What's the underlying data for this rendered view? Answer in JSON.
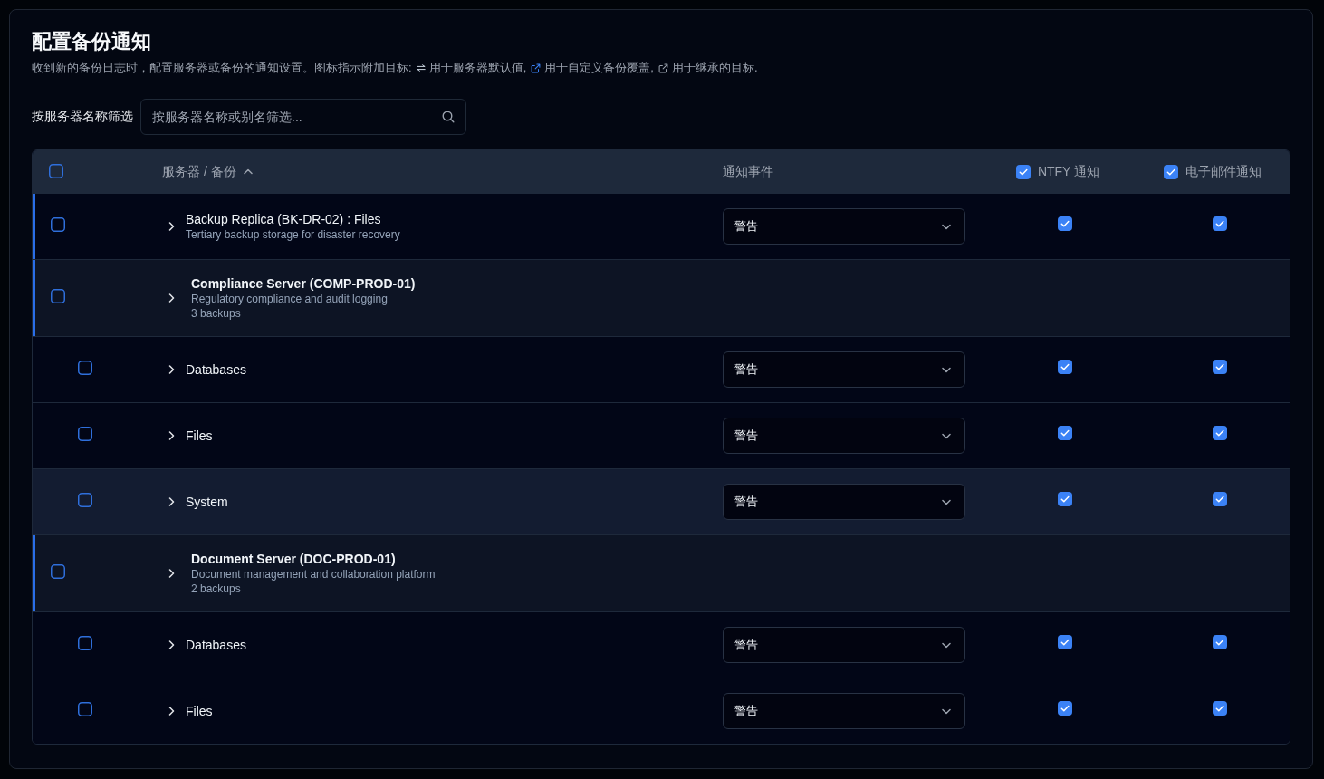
{
  "title": "配置备份通知",
  "description": {
    "intro": "收到新的备份日志时，配置服务器或备份的通知设置。图标指示附加目标:",
    "legend": [
      {
        "kind": "server-default",
        "text": "用于服务器默认值,"
      },
      {
        "kind": "custom-override",
        "text": "用于自定义备份覆盖,"
      },
      {
        "kind": "inherited",
        "text": "用于继承的目标."
      }
    ]
  },
  "filter": {
    "label": "按服务器名称筛选",
    "placeholder": "按服务器名称或别名筛选..."
  },
  "table": {
    "columns": [
      {
        "kind": "select",
        "checked": false
      },
      {
        "kind": "name",
        "label": "服务器 / 备份",
        "sort_ascending": true
      },
      {
        "kind": "event",
        "label": "通知事件"
      },
      {
        "kind": "ntfy",
        "label": "NTFY 通知",
        "checked": true
      },
      {
        "kind": "email",
        "label": "电子邮件通知",
        "checked": true
      }
    ],
    "rows": [
      {
        "kind": "backup",
        "name": "Backup Replica (BK-DR-02) : Files",
        "description": "Tertiary backup storage for disaster recovery",
        "selected": false,
        "highlighted": false,
        "event": "警告",
        "ntfy_checked": true,
        "email_checked": true
      },
      {
        "kind": "server",
        "name": "Compliance Server (COMP-PROD-01)",
        "description": "Regulatory compliance and audit logging",
        "count": "3 backups",
        "selected": false,
        "children": [
          {
            "kind": "backup",
            "name": "Databases",
            "selected": false,
            "highlighted": false,
            "event": "警告",
            "ntfy_checked": true,
            "email_checked": true
          },
          {
            "kind": "backup",
            "name": "Files",
            "selected": false,
            "highlighted": false,
            "event": "警告",
            "ntfy_checked": true,
            "email_checked": true
          },
          {
            "kind": "backup",
            "name": "System",
            "selected": false,
            "highlighted": true,
            "event": "警告",
            "ntfy_checked": true,
            "email_checked": true
          }
        ]
      },
      {
        "kind": "server",
        "name": "Document Server (DOC-PROD-01)",
        "description": "Document management and collaboration platform",
        "count": "2 backups",
        "selected": false,
        "children": [
          {
            "kind": "backup",
            "name": "Databases",
            "selected": false,
            "highlighted": false,
            "event": "警告",
            "ntfy_checked": true,
            "email_checked": true
          },
          {
            "kind": "backup",
            "name": "Files",
            "selected": false,
            "highlighted": false,
            "event": "警告",
            "ntfy_checked": true,
            "email_checked": true
          }
        ]
      }
    ]
  }
}
